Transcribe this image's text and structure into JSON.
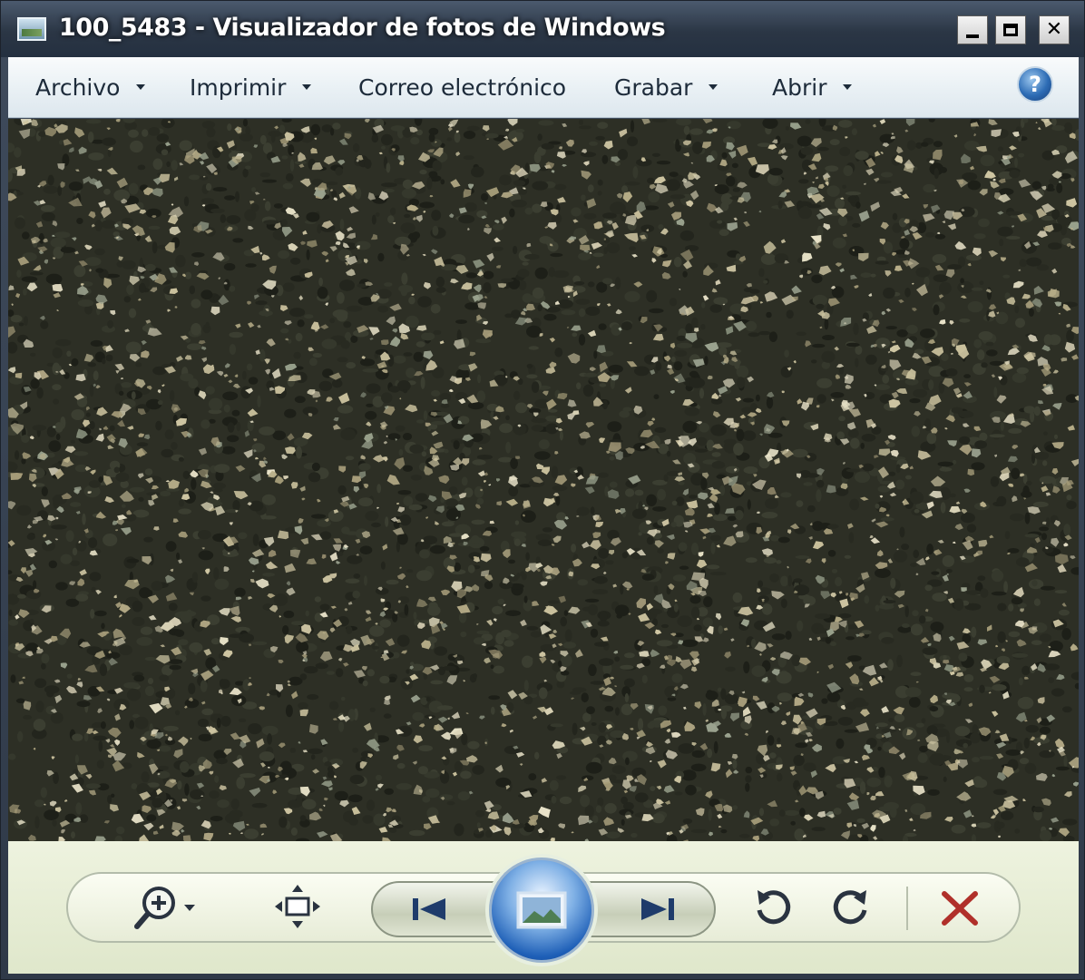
{
  "window": {
    "title": "100_5483 - Visualizador de fotos de Windows"
  },
  "menu": {
    "items": [
      {
        "label": "Archivo",
        "has_dropdown": true
      },
      {
        "label": "Imprimir",
        "has_dropdown": true
      },
      {
        "label": "Correo electrónico",
        "has_dropdown": false
      },
      {
        "label": "Grabar",
        "has_dropdown": true
      },
      {
        "label": "Abrir",
        "has_dropdown": true
      }
    ],
    "help_icon": "help-icon"
  },
  "photo": {
    "subject": "gravel-asphalt-texture"
  },
  "toolbar": {
    "icons": [
      "zoom-icon",
      "fit-window-icon",
      "previous-icon",
      "slideshow-icon",
      "next-icon",
      "rotate-left-icon",
      "rotate-right-icon",
      "delete-icon"
    ]
  },
  "colors": {
    "title_bar": "#2b3645",
    "menu_bar": "#eaf1f5",
    "bottom_bar": "#dfe7cb",
    "slideshow_accent": "#1e5fb7",
    "delete_red": "#b0302a"
  }
}
